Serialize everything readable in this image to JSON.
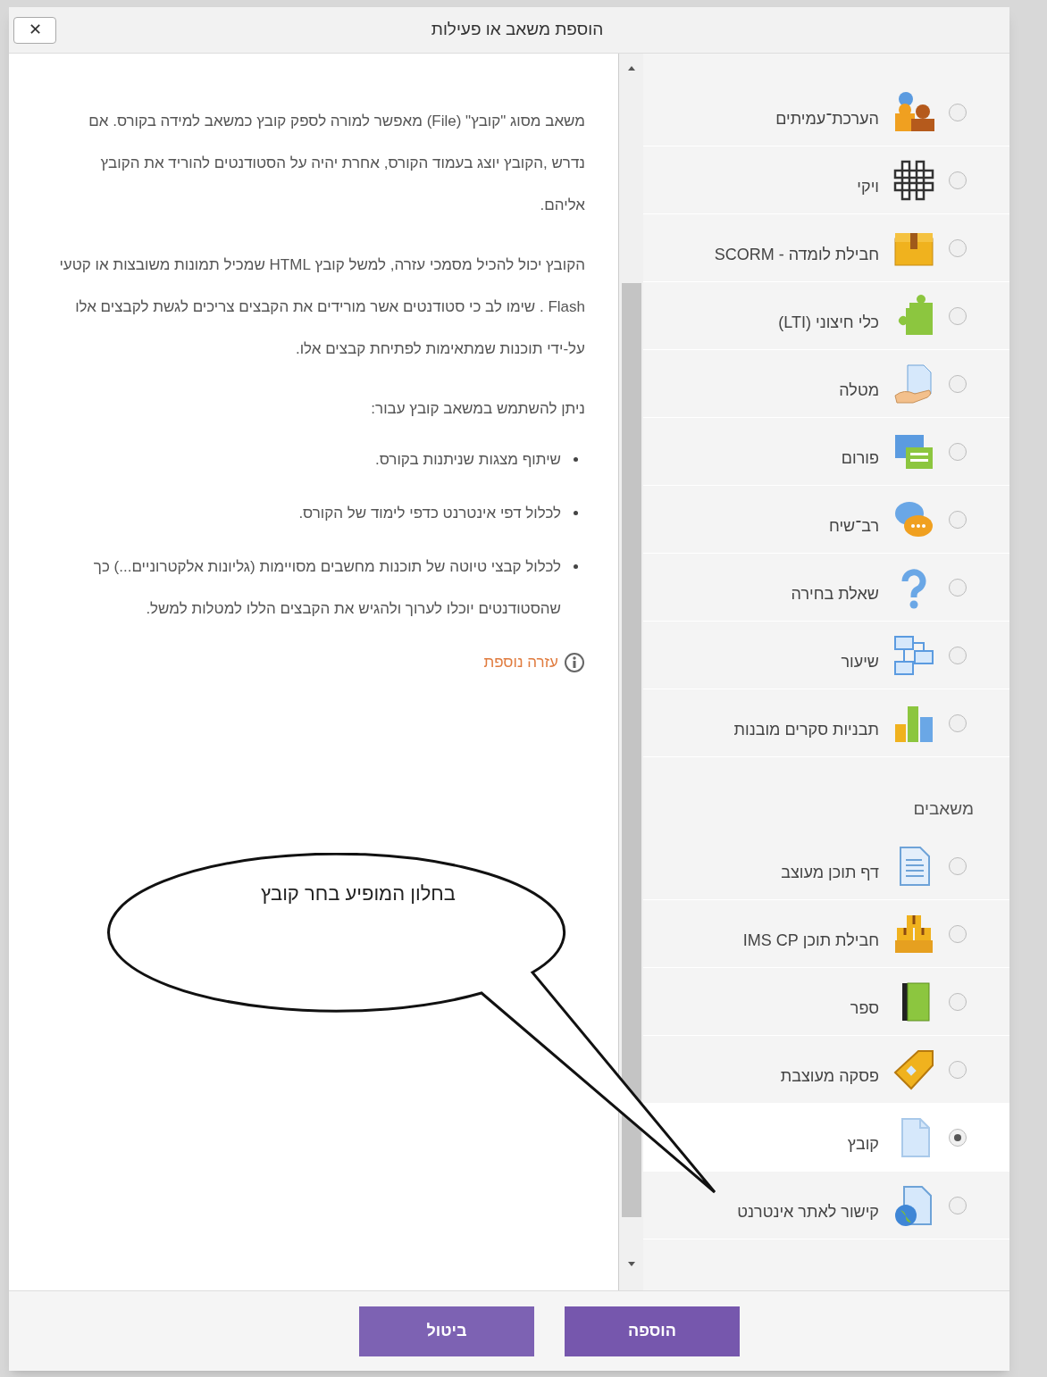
{
  "dialog": {
    "title": "הוספת משאב או פעילות",
    "close_button": "✕"
  },
  "description": {
    "paragraphs": [
      "משאב מסוג \"קובץ\" (File) מאפשר למורה לספק קובץ כמשאב למידה בקורס. אם נדרש ,הקובץ יוצג בעמוד הקורס, אחרת יהיה על הסטודנטים להוריד את הקובץ אליהם.",
      "הקובץ יכול להכיל מסמכי עזרה, למשל קובץ HTML שמכיל תמונות משובצות או קטעי Flash . שימו לב כי סטודנטים אשר מורידים את הקבצים צריכים לגשת לקבצים אלו על-ידי תוכנות שמתאימות לפתיחת קבצים אלו."
    ],
    "uses_intro": "ניתן להשתמש במשאב קובץ עבור:",
    "uses": [
      "שיתוף מצגות שניתנות בקורס.",
      "לכלול דפי אינטרנט כדפי לימוד של הקורס.",
      "לכלול קבצי טיוטה של תוכנות מחשבים מסויימות (גליונות אלקטרוניים...) כך שהסטודנטים יוכלו לערוך ולהגיש את הקבצים הללו למטלות למשל."
    ],
    "help_link": "עזרה נוספת"
  },
  "list": [
    {
      "kind": "activity",
      "label": "הערכת־עמיתים",
      "selected": false
    },
    {
      "kind": "activity",
      "label": "ויקי",
      "selected": false
    },
    {
      "kind": "activity",
      "label": "חבילת לומדה - SCORM",
      "selected": false
    },
    {
      "kind": "activity",
      "label": "כלי חיצוני (LTI)",
      "selected": false
    },
    {
      "kind": "activity",
      "label": "מטלה",
      "selected": false
    },
    {
      "kind": "activity",
      "label": "פורום",
      "selected": false
    },
    {
      "kind": "activity",
      "label": "רב־שיח",
      "selected": false
    },
    {
      "kind": "activity",
      "label": "שאלת בחירה",
      "selected": false
    },
    {
      "kind": "activity",
      "label": "שיעור",
      "selected": false
    },
    {
      "kind": "activity",
      "label": "תבניות סקרים מובנות",
      "selected": false
    },
    {
      "kind": "heading",
      "label": "משאבים"
    },
    {
      "kind": "activity",
      "label": "דף תוכן מעוצב",
      "selected": false
    },
    {
      "kind": "activity",
      "label": "חבילת תוכן IMS CP",
      "selected": false
    },
    {
      "kind": "activity",
      "label": "ספר",
      "selected": false
    },
    {
      "kind": "activity",
      "label": "פסקה מעוצבת",
      "selected": false
    },
    {
      "kind": "activity",
      "label": "קובץ",
      "selected": true
    },
    {
      "kind": "activity",
      "label": "קישור לאתר אינטרנט",
      "selected": false
    }
  ],
  "buttons": [
    {
      "kind": "primary",
      "label": "הוספה"
    },
    {
      "kind": "secondary",
      "label": "ביטול"
    }
  ],
  "annotation": {
    "text": "בחלון המופיע בחר קובץ"
  }
}
